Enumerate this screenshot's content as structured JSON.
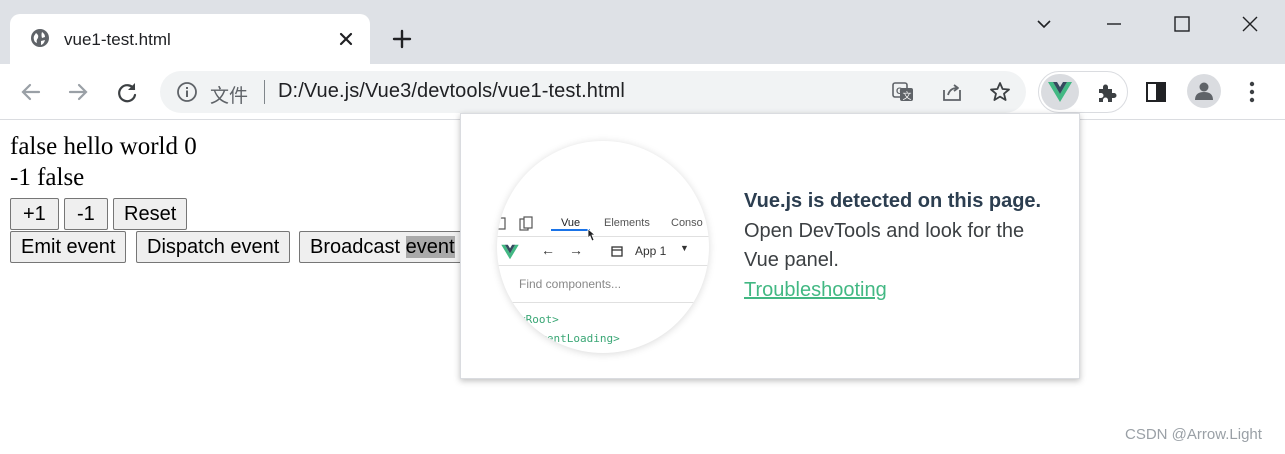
{
  "tab": {
    "title": "vue1-test.html"
  },
  "toolbar": {
    "scheme": "文件",
    "url": "D:/Vue.js/Vue3/devtools/vue1-test.html"
  },
  "page": {
    "line1": "false hello world 0",
    "line2": "-1 false",
    "buttons_row1": [
      "+1",
      "-1",
      "Reset"
    ],
    "buttons_row2": [
      "Emit event",
      "Dispatch event"
    ],
    "broadcast_prefix": "Broadcast ",
    "broadcast_highlight": "event"
  },
  "popup": {
    "title": "Vue.js is detected on this page.",
    "body": "Open DevTools and look for the Vue panel.",
    "link": "Troubleshooting",
    "preview": {
      "tab_vue": "Vue",
      "tab_elements": "Elements",
      "tab_console": "Conso",
      "app_select": "App 1",
      "search_placeholder": "Find components...",
      "code1": "<Root>",
      "code2": "<EventLoading>"
    }
  },
  "watermark": "CSDN @Arrow.Light",
  "colors": {
    "vue_green": "#42b883",
    "vue_dark": "#35495e",
    "tabstrip": "#dee1e6",
    "omnibox": "#f1f3f4"
  }
}
